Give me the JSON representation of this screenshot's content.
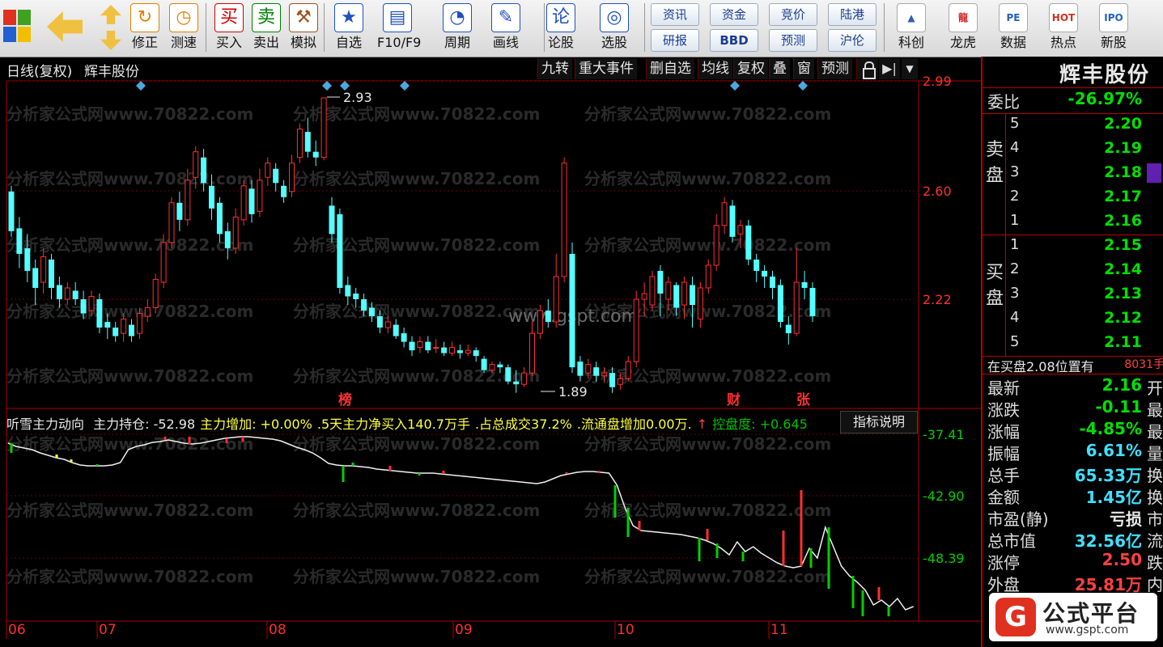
{
  "toolbar": {
    "items": [
      {
        "label": "修正",
        "icon": "refresh-icon",
        "color": "#e08000"
      },
      {
        "label": "测速",
        "icon": "clock-icon",
        "color": "#e08000"
      },
      {
        "label": "买入",
        "icon": "buy-icon",
        "glyph": "买",
        "color": "#d00000"
      },
      {
        "label": "卖出",
        "icon": "sell-icon",
        "glyph": "卖",
        "color": "#008000"
      },
      {
        "label": "模拟",
        "icon": "hammer-icon",
        "color": "#a05020"
      },
      {
        "label": "自选",
        "icon": "star-icon",
        "color": "#2050c0"
      },
      {
        "label": "F10/F9",
        "icon": "f10-icon",
        "color": "#2050c0"
      },
      {
        "label": "周期",
        "icon": "period-icon",
        "color": "#2050c0"
      },
      {
        "label": "画线",
        "icon": "pencil-icon",
        "color": "#2050c0"
      },
      {
        "label": "论股",
        "icon": "discuss-icon",
        "glyph": "论",
        "color": "#2050c0"
      },
      {
        "label": "选股",
        "icon": "pick-icon",
        "color": "#2050c0"
      }
    ],
    "small_buttons": [
      [
        "资讯",
        "研报"
      ],
      [
        "资金",
        "BBD"
      ],
      [
        "竞价",
        "预测"
      ],
      [
        "陆港",
        "沪伦"
      ]
    ],
    "right_items": [
      {
        "label": "科创",
        "icon": "kechuang-icon"
      },
      {
        "label": "龙虎",
        "icon": "dragon-icon"
      },
      {
        "label": "数据",
        "icon": "data-icon",
        "glyph": "PE"
      },
      {
        "label": "热点",
        "icon": "hot-icon",
        "glyph": "HOT"
      },
      {
        "label": "新股",
        "icon": "ipo-icon",
        "glyph": "IPO"
      }
    ]
  },
  "header": {
    "period": "日线(复权)",
    "stock_name": "辉丰股份",
    "menu": [
      "九转",
      "重大事件",
      "删自选",
      "均线",
      "复权",
      "叠",
      "窗",
      "预测"
    ]
  },
  "price_chart": {
    "yticks": [
      "2.99",
      "2.60",
      "2.22"
    ],
    "high_label": "2.93",
    "low_label": "1.89",
    "markers": [
      "榜",
      "财",
      "张"
    ],
    "watermark_center": "www.gspt.com"
  },
  "indicator": {
    "name": "听雪主力动向",
    "items": [
      {
        "text": "主力持仓: -52.98",
        "color": "#e8e8e8"
      },
      {
        "text": "主力增加: +0.00%",
        "color": "#ffff40"
      },
      {
        "text": ".5天主力净买入140.7万手",
        "color": "#ffff40"
      },
      {
        "text": ".占总成交37.2%",
        "color": "#ffff40"
      },
      {
        "text": ".流通盘增加0.00万.",
        "color": "#ffff40"
      },
      {
        "text": "↑",
        "color": "#ff4040"
      },
      {
        "text": "控盘度: +0.645",
        "color": "#00c000"
      }
    ],
    "explain_button": "指标说明",
    "yticks": [
      "-37.41",
      "-42.90",
      "-48.39"
    ]
  },
  "months": [
    "06",
    "07",
    "08",
    "09",
    "10",
    "11"
  ],
  "watermark": "分析家公式网www.70822.com",
  "right_panel": {
    "title": "辉丰股份",
    "weibi_label": "委比",
    "weibi_value": "-26.97%",
    "sell_label": [
      "卖",
      "盘"
    ],
    "buy_label": [
      "买",
      "盘"
    ],
    "sells": [
      {
        "idx": "5",
        "price": "2.20"
      },
      {
        "idx": "4",
        "price": "2.19"
      },
      {
        "idx": "3",
        "price": "2.18"
      },
      {
        "idx": "2",
        "price": "2.17"
      },
      {
        "idx": "1",
        "price": "2.16"
      }
    ],
    "buys": [
      {
        "idx": "1",
        "price": "2.15"
      },
      {
        "idx": "2",
        "price": "2.14"
      },
      {
        "idx": "3",
        "price": "2.13"
      },
      {
        "idx": "4",
        "price": "2.12"
      },
      {
        "idx": "5",
        "price": "2.11"
      }
    ],
    "notice": "在买盘2.08位置有",
    "notice_value": "8031手",
    "stats": [
      {
        "label": "最新",
        "value": "2.16",
        "color": "#00e000",
        "tail": "开"
      },
      {
        "label": "涨跌",
        "value": "-0.11",
        "color": "#00e000",
        "tail": "最"
      },
      {
        "label": "涨幅",
        "value": "-4.85%",
        "color": "#00e000",
        "tail": "最"
      },
      {
        "label": "振幅",
        "value": "6.61%",
        "color": "#40e0ff",
        "tail": "量"
      },
      {
        "label": "总手",
        "value": "65.33万",
        "color": "#40e0ff",
        "tail": "换"
      },
      {
        "label": "金额",
        "value": "1.45亿",
        "color": "#40e0ff",
        "tail": "换"
      },
      {
        "label": "市盈(静)",
        "value": "亏损",
        "color": "#e8e8e8",
        "tail": "市"
      },
      {
        "label": "总市值",
        "value": "32.56亿",
        "color": "#40e0ff",
        "tail": "流"
      },
      {
        "label": "涨停",
        "value": "2.50",
        "color": "#ff4040",
        "tail": "跌"
      },
      {
        "label": "外盘",
        "value": "25.81万",
        "color": "#ff4040",
        "tail": "内"
      }
    ]
  },
  "logo": {
    "text": "公式平台",
    "url": "www.gspt.com"
  }
}
